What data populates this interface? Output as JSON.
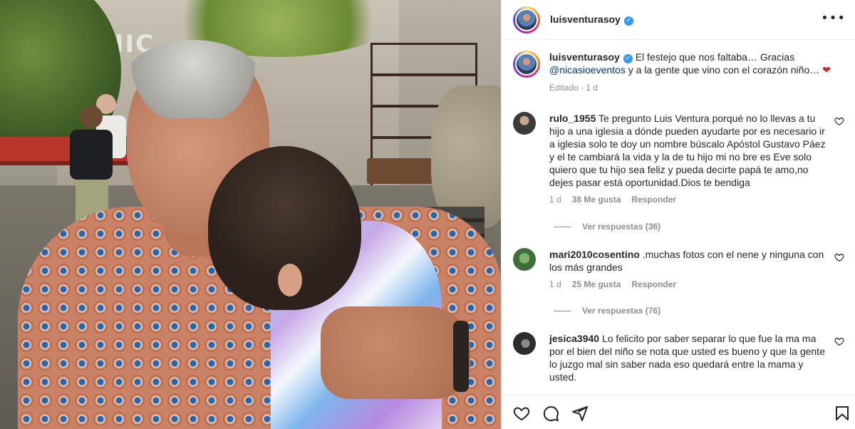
{
  "photo": {
    "sign_text": "NIC"
  },
  "header": {
    "username": "luisventurasoy",
    "verified_glyph": "✓",
    "more_glyph": "•••"
  },
  "caption": {
    "username": "luisventurasoy",
    "verified_glyph": "✓",
    "text_before": "El festejo que nos faltaba… Gracias",
    "mention": "@nicasioeventos",
    "text_after": "y a la gente que vino con el corazón niño…",
    "emoji": "❤",
    "meta": "Editado · 1 d"
  },
  "comments": [
    {
      "username": "rulo_1955",
      "text": "Te pregunto Luis Ventura porqué no lo llevas a tu hijo a una iglesia a dónde pueden ayudarte por es necesario ir a iglesia solo te doy un nombre búscalo Apóstol Gustavo Páez y el te cambiará la vida y la de tu hijo mi no bre es Eve solo quiero que tu hijo sea feliz y pueda decirte papá te amo,no dejes pasar está oportunidad.Dios te bendiga",
      "time": "1 d",
      "likes": "38 Me gusta",
      "reply": "Responder",
      "replies": "Ver respuestas (36)"
    },
    {
      "username": "mari2010cosentino",
      "text": ".muchas fotos con el nene y ninguna con los más grandes",
      "time": "1 d",
      "likes": "25 Me gusta",
      "reply": "Responder",
      "replies": "Ver respuestas (76)"
    },
    {
      "username": "jesica3940",
      "text": "Lo felicito por saber separar lo que fue la ma ma por el bien del niño se nota que usted es bueno y que la gente lo juzgo mal sin saber nada eso quedará entre la mama y usted."
    }
  ],
  "icons": {
    "like": "heart-icon",
    "comment": "comment-icon",
    "share": "share-icon",
    "save": "bookmark-icon"
  }
}
